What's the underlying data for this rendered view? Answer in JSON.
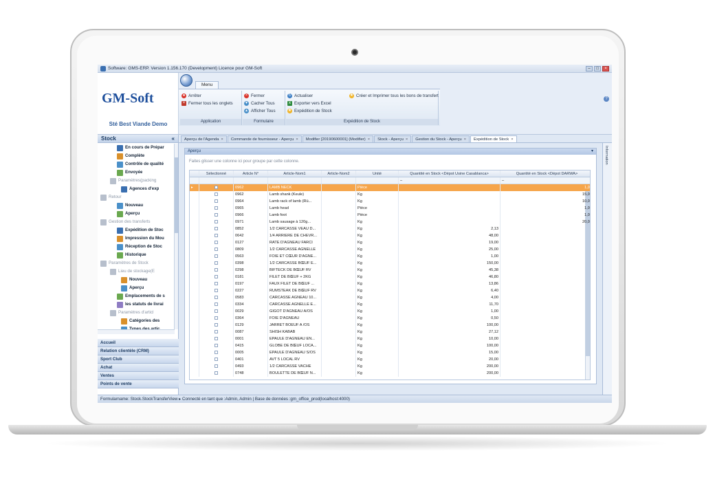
{
  "window": {
    "title": "Software: GMS-ERP. Version 1.156.170 (Development) Licence pour GM-Soft"
  },
  "logo": {
    "text": "GM-Soft",
    "company": "Sté Best Viande Demo"
  },
  "ribbon": {
    "tab": "Menu",
    "groups": {
      "application": {
        "label": "Application",
        "items": [
          "Arrêter",
          "Fermer tous les onglets"
        ]
      },
      "formulaire": {
        "label": "Formulaire",
        "items": [
          "Fermer",
          "Cacher Tous",
          "Afficher Tous"
        ]
      },
      "expedition": {
        "label": "Expédition de Stock",
        "items": [
          "Actualiser",
          "Exporter vers Excel",
          "Expédition de Stock",
          "Créer et Imprimer tous les bons de transfert"
        ]
      }
    }
  },
  "sidebar": {
    "title": "Stock",
    "tree": [
      {
        "label": "En cours de Prépar",
        "style": "bold",
        "indent": 28
      },
      {
        "label": "Complète",
        "style": "bold",
        "indent": 28
      },
      {
        "label": "Contrôle de qualité",
        "style": "bold",
        "indent": 28
      },
      {
        "label": "Envoyée",
        "style": "bold",
        "indent": 28
      },
      {
        "label": "Paramètres(packing",
        "style": "gray",
        "indent": 18
      },
      {
        "label": "Agences d'exp",
        "style": "bold",
        "indent": 34
      },
      {
        "label": "Retour",
        "style": "gray",
        "indent": 4
      },
      {
        "label": "Nouveau",
        "style": "bold",
        "indent": 28
      },
      {
        "label": "Aperçu",
        "style": "bold",
        "indent": 28
      },
      {
        "label": "Gestion des transferts",
        "style": "gray",
        "indent": 4
      },
      {
        "label": "Expédition de Stoc",
        "style": "bold",
        "indent": 28
      },
      {
        "label": "Impression du Mou",
        "style": "bold",
        "indent": 28
      },
      {
        "label": "Réception de Stoc",
        "style": "bold",
        "indent": 28
      },
      {
        "label": "Historique",
        "style": "bold",
        "indent": 28
      },
      {
        "label": "Paramètres de Stock",
        "style": "gray",
        "indent": 4
      },
      {
        "label": "Lieu de stockage(E",
        "style": "gray",
        "indent": 18
      },
      {
        "label": "Nouveau",
        "style": "bold",
        "indent": 34
      },
      {
        "label": "Aperçu",
        "style": "bold",
        "indent": 34
      },
      {
        "label": "Emplacements de s",
        "style": "bold",
        "indent": 28
      },
      {
        "label": "les statuts de livrai",
        "style": "bold",
        "indent": 28
      },
      {
        "label": "Paramètres d'articl",
        "style": "gray",
        "indent": 18
      },
      {
        "label": "Catégories des",
        "style": "bold",
        "indent": 34
      },
      {
        "label": "Types des artic",
        "style": "bold",
        "indent": 34
      }
    ],
    "sections": [
      "Accueil",
      "Relation clientèle (CRM)",
      "Sport Club",
      "Achat",
      "Ventes",
      "Points de vente"
    ]
  },
  "tabs": [
    {
      "label": "Aperçu de l'Agenda",
      "active": false
    },
    {
      "label": "Commande de fournisseur - Aperçu",
      "active": false
    },
    {
      "label": "Modifier [20190600001] (Modifier)",
      "active": false
    },
    {
      "label": "Stock - Aperçu",
      "active": false
    },
    {
      "label": "Gestion du Stock - Aperçu",
      "active": false
    },
    {
      "label": "Expédition de Stock",
      "active": true
    }
  ],
  "panel": {
    "title": "Aperçu",
    "group_hint": "Faites glisser une colonne ici pour groupe par cette colonne."
  },
  "grid": {
    "columns": [
      {
        "label": "Sélectionné",
        "width": 50
      },
      {
        "label": "Article N°",
        "width": 50
      },
      {
        "label": "Article-Nom1",
        "width": 78
      },
      {
        "label": "Article-Nom2",
        "width": 50
      },
      {
        "label": "Unité",
        "width": 62
      },
      {
        "label": "Quantité en Stock <Dépot Usine Casablanca>",
        "width": 148
      },
      {
        "label": "Quantité en Stock <Dépot DARWA>",
        "width": 136
      }
    ],
    "filter_value": "–",
    "rows": [
      {
        "n": "0962",
        "nom1": "LAMB NECK",
        "unite": "Pièce",
        "q1": "",
        "q2": "1,00",
        "selected": true
      },
      {
        "n": "0962",
        "nom1": "Lamb shank (Keule)",
        "unite": "Kg",
        "q1": "",
        "q2": "15,00"
      },
      {
        "n": "0964",
        "nom1": "Lamb rack of lamb (Rü...",
        "unite": "Kg",
        "q1": "",
        "q2": "10,00"
      },
      {
        "n": "0965",
        "nom1": "Lamb head",
        "unite": "Pièce",
        "q1": "",
        "q2": "1,00"
      },
      {
        "n": "0966",
        "nom1": "Lamb foot",
        "unite": "Pièce",
        "q1": "",
        "q2": "1,00"
      },
      {
        "n": "0971",
        "nom1": "Lamb sausage à 120g...",
        "unite": "Kg",
        "q1": "",
        "q2": "20,00"
      },
      {
        "n": "0852",
        "nom1": "1/2 CARCASSE VEAU D...",
        "unite": "Kg",
        "q1": "2,13",
        "q2": ""
      },
      {
        "n": "0642",
        "nom1": "1/4 ARRIERE DE CHEVR...",
        "unite": "Kg",
        "q1": "48,00",
        "q2": ""
      },
      {
        "n": "0127",
        "nom1": "RATE D'AGNEAU FARCI",
        "unite": "Kg",
        "q1": "19,00",
        "q2": ""
      },
      {
        "n": "0809",
        "nom1": "1/2 CARCASSE AGNELLE",
        "unite": "Kg",
        "q1": "25,00",
        "q2": ""
      },
      {
        "n": "0563",
        "nom1": "FOIE ET CŒUR D'AGNE...",
        "unite": "Kg",
        "q1": "1,00",
        "q2": ""
      },
      {
        "n": "0398",
        "nom1": "1/2 CARCASSE BŒUF E...",
        "unite": "Kg",
        "q1": "150,00",
        "q2": ""
      },
      {
        "n": "0298",
        "nom1": "BIFTECK DE BŒUF RV",
        "unite": "Kg",
        "q1": "45,38",
        "q2": ""
      },
      {
        "n": "0181",
        "nom1": "FILET DE BŒUF + 2KG",
        "unite": "Kg",
        "q1": "46,80",
        "q2": ""
      },
      {
        "n": "0197",
        "nom1": "FAUX FILET DE BŒUF ...",
        "unite": "Kg",
        "q1": "13,86",
        "q2": ""
      },
      {
        "n": "0227",
        "nom1": "RUMSTEAK DE BŒUF RV",
        "unite": "Kg",
        "q1": "6,40",
        "q2": ""
      },
      {
        "n": "0583",
        "nom1": "CARCASSE AGNEAU 10...",
        "unite": "Kg",
        "q1": "4,00",
        "q2": ""
      },
      {
        "n": "0334",
        "nom1": "CARCASSE AGNELLE E...",
        "unite": "Kg",
        "q1": "11,70",
        "q2": ""
      },
      {
        "n": "0029",
        "nom1": "GIGOT D'AGNEAU A/OS",
        "unite": "Kg",
        "q1": "1,00",
        "q2": ""
      },
      {
        "n": "0364",
        "nom1": "FOIE D'AGNEAU",
        "unite": "Kg",
        "q1": "0,50",
        "q2": ""
      },
      {
        "n": "0129",
        "nom1": "JARRET BOEUF A /OS",
        "unite": "Kg",
        "q1": "100,00",
        "q2": ""
      },
      {
        "n": "0087",
        "nom1": "SHISH KABAB",
        "unite": "Kg",
        "q1": "27,12",
        "q2": ""
      },
      {
        "n": "0001",
        "nom1": "EPAULE D'AGNEAU EN...",
        "unite": "Kg",
        "q1": "10,00",
        "q2": ""
      },
      {
        "n": "0415",
        "nom1": "GLOBE DE BŒUF LOCA...",
        "unite": "Kg",
        "q1": "100,00",
        "q2": ""
      },
      {
        "n": "0005",
        "nom1": "EPAULE D'AGNEAU S/OS",
        "unite": "Kg",
        "q1": "15,00",
        "q2": ""
      },
      {
        "n": "0401",
        "nom1": "AVT 5 LOCAL RV",
        "unite": "Kg",
        "q1": "20,00",
        "q2": ""
      },
      {
        "n": "0493",
        "nom1": "1/2 CARCASSE VACHE",
        "unite": "Kg",
        "q1": "200,00",
        "q2": ""
      },
      {
        "n": "0748",
        "nom1": "BOULETTE DE BŒUF N...",
        "unite": "Kg",
        "q1": "200,00",
        "q2": ""
      }
    ]
  },
  "right_strip": {
    "label": "Information"
  },
  "statusbar": {
    "text": "Formularname: Stock.StockTransferView  ▸  Connecté en tant que :Admin, Admin | Base de données :gm_office_prod(localhost:4000)"
  },
  "colors": {
    "accent": "#2f5d9a",
    "selection": "#f6a54a",
    "panel_bg": "#dfe8f4"
  }
}
